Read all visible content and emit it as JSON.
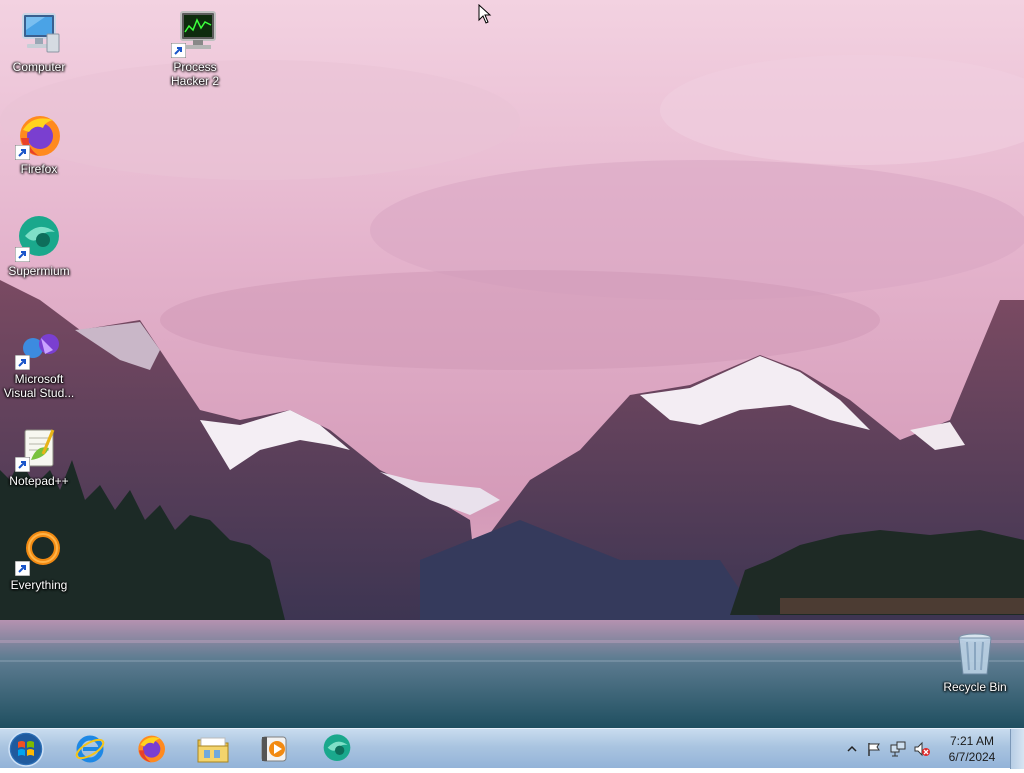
{
  "desktop": {
    "icons": [
      {
        "label": "Computer",
        "icon": "computer-icon"
      },
      {
        "label": "Process Hacker 2",
        "icon": "process-hacker-icon"
      },
      {
        "label": "Firefox",
        "icon": "firefox-icon"
      },
      {
        "label": "Supermium",
        "icon": "supermium-icon"
      },
      {
        "label": "Microsoft Visual Stud...",
        "icon": "visual-studio-icon"
      },
      {
        "label": "Notepad++",
        "icon": "notepadpp-icon"
      },
      {
        "label": "Everything",
        "icon": "everything-icon"
      },
      {
        "label": "Recycle Bin",
        "icon": "recycle-bin-icon"
      }
    ]
  },
  "taskbar": {
    "pinned": [
      "internet-explorer-icon",
      "firefox-icon",
      "file-explorer-icon",
      "media-player-icon",
      "supermium-icon"
    ],
    "tray": [
      "show-hidden-icons-icon",
      "action-center-flag-icon",
      "network-icon",
      "volume-muted-icon"
    ],
    "clock": {
      "time": "7:21 AM",
      "date": "6/7/2024"
    }
  },
  "colors": {
    "sky": "#e8b8cf",
    "water": "#2f6a7c",
    "taskbar": "#a9c4e0"
  }
}
